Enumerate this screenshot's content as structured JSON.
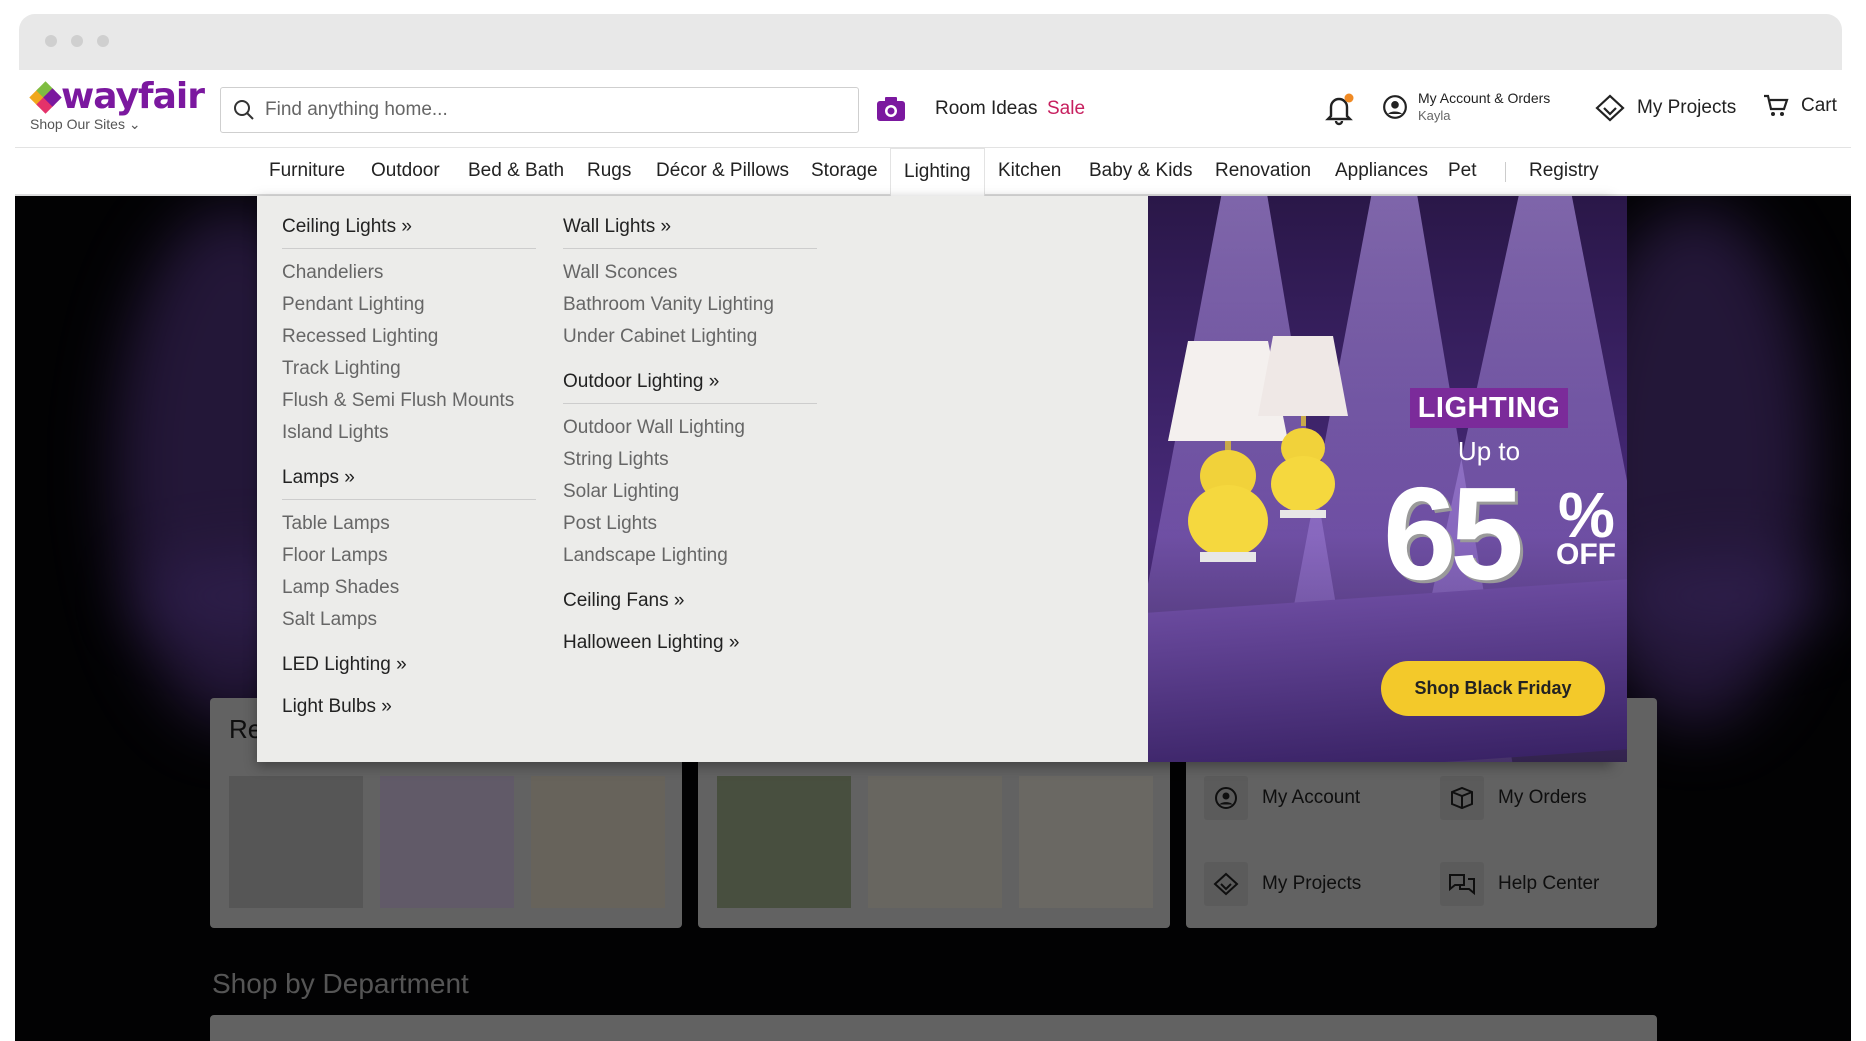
{
  "header": {
    "logo_text": "wayfair",
    "shop_sites": "Shop Our Sites ⌄",
    "search_placeholder": "Find anything home...",
    "room_ideas": "Room Ideas",
    "sale": "Sale",
    "account_line1": "My Account & Orders",
    "account_line2": "Kayla",
    "my_projects": "My Projects",
    "cart": "Cart"
  },
  "nav": {
    "items": [
      "Furniture",
      "Outdoor",
      "Bed & Bath",
      "Rugs",
      "Décor & Pillows",
      "Storage",
      "Lighting",
      "Kitchen",
      "Baby & Kids",
      "Renovation",
      "Appliances",
      "Pet",
      "Registry"
    ],
    "active": "Lighting"
  },
  "mega_menu": {
    "col1": {
      "ceiling": {
        "title": "Ceiling Lights »",
        "items": [
          "Chandeliers",
          "Pendant Lighting",
          "Recessed Lighting",
          "Track Lighting",
          "Flush & Semi Flush Mounts",
          "Island Lights"
        ]
      },
      "lamps": {
        "title": "Lamps »",
        "items": [
          "Table Lamps",
          "Floor Lamps",
          "Lamp Shades",
          "Salt Lamps"
        ]
      },
      "led": "LED Lighting »",
      "bulbs": "Light Bulbs »"
    },
    "col2": {
      "wall": {
        "title": "Wall Lights »",
        "items": [
          "Wall Sconces",
          "Bathroom Vanity Lighting",
          "Under Cabinet Lighting"
        ]
      },
      "outdoor": {
        "title": "Outdoor Lighting »",
        "items": [
          "Outdoor Wall Lighting",
          "String Lights",
          "Solar Lighting",
          "Post Lights",
          "Landscape Lighting"
        ]
      },
      "fans": "Ceiling Fans »",
      "halloween": "Halloween Lighting »"
    }
  },
  "promo": {
    "tag": "LIGHTING",
    "up_to": "Up to",
    "percent": "65",
    "percent_sign": "%",
    "off": "OFF",
    "cta": "Shop Black Friday"
  },
  "page": {
    "recent_title": "Re",
    "account_links": [
      "My Account",
      "My Orders",
      "My Projects",
      "Help Center"
    ],
    "shop_by_department": "Shop by Department"
  },
  "colors": {
    "brand_purple": "#7b189f",
    "sale_red": "#c7205f",
    "cta_yellow": "#f3c92a",
    "notification_dot": "#f08a24"
  }
}
